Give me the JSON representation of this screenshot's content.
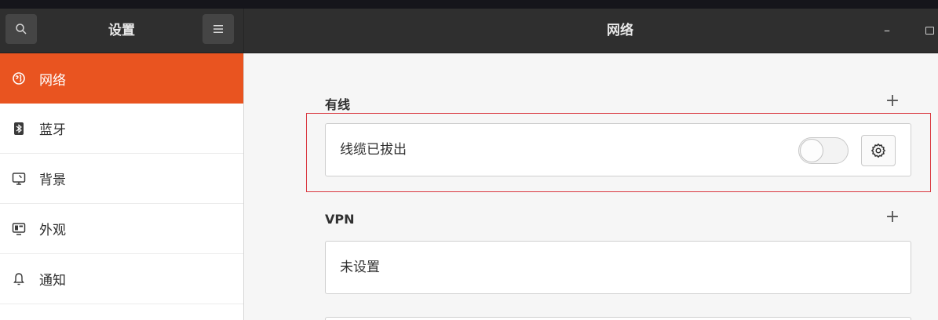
{
  "header": {
    "left_title": "设置",
    "main_title": "网络",
    "minimize_label": "–"
  },
  "sidebar": {
    "items": [
      {
        "label": "网络",
        "icon": "network-icon",
        "active": true
      },
      {
        "label": "蓝牙",
        "icon": "bluetooth-icon",
        "active": false
      },
      {
        "label": "背景",
        "icon": "background-icon",
        "active": false
      },
      {
        "label": "外观",
        "icon": "appearance-icon",
        "active": false
      },
      {
        "label": "通知",
        "icon": "notification-bell-icon",
        "active": false
      }
    ]
  },
  "main": {
    "wired": {
      "title": "有线",
      "add_label": "+",
      "connection_label": "线缆已拔出",
      "toggle_on": false
    },
    "vpn": {
      "title": "VPN",
      "add_label": "+",
      "status_label": "未设置"
    }
  },
  "colors": {
    "accent": "#e95420",
    "highlight": "#d9363e",
    "headerbar": "#2f2f2f"
  }
}
